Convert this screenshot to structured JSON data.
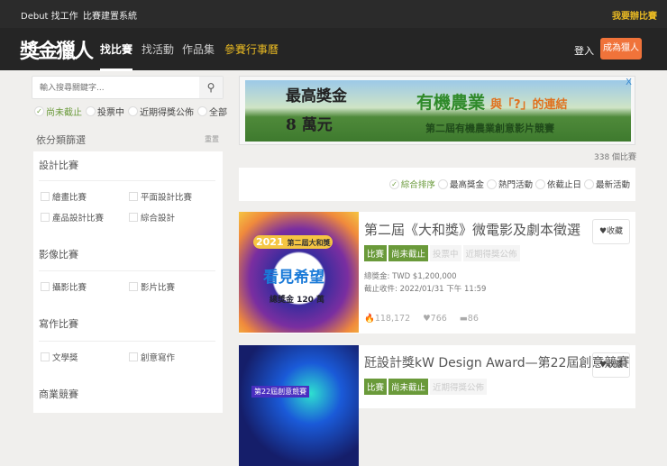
{
  "topbar": {
    "links": [
      "Debut 找工作",
      "比賽建置系統"
    ],
    "host": "我要辦比賽"
  },
  "nav": {
    "logo": "獎金獵人",
    "items": [
      "找比賽",
      "找活動",
      "作品集",
      "參賽行事曆"
    ],
    "login": "登入",
    "join": "成為獵人"
  },
  "search": {
    "placeholder": "輸入搜尋關鍵字...",
    "icon": "search-icon"
  },
  "status_filters": [
    {
      "label": "尚未截止",
      "checked": true
    },
    {
      "label": "投票中",
      "checked": false
    },
    {
      "label": "近期得獎公佈",
      "checked": false
    },
    {
      "label": "全部",
      "checked": false
    }
  ],
  "filter": {
    "title": "依分類篩選",
    "reset": "重置",
    "categories": [
      {
        "name": "設計比賽",
        "options": [
          "繪畫比賽",
          "平面設計比賽",
          "產品設計比賽",
          "綜合設計"
        ]
      },
      {
        "name": "影像比賽",
        "options": [
          "攝影比賽",
          "影片比賽"
        ]
      },
      {
        "name": "寫作比賽",
        "options": [
          "文學獎",
          "創意寫作"
        ]
      },
      {
        "name": "商業競賽",
        "options": []
      }
    ]
  },
  "ad": {
    "line1": "最高獎金",
    "line2": "8 萬元",
    "headline": "有機農業",
    "headline2": "與「?」的連結",
    "sub": "第二屆有機農業創意影片競賽",
    "close": "X"
  },
  "count": "338 個比賽",
  "sort": [
    {
      "label": "綜合排序",
      "checked": true
    },
    {
      "label": "最高獎金",
      "checked": false
    },
    {
      "label": "熱門活動",
      "checked": false
    },
    {
      "label": "依截止日",
      "checked": false
    },
    {
      "label": "最新活動",
      "checked": false
    }
  ],
  "contests": [
    {
      "title": "第二屆《大和獎》微電影及劇本徵選",
      "fav": "收藏",
      "tags": [
        {
          "t": "比賽",
          "on": true
        },
        {
          "t": "尚未截止",
          "on": true
        },
        {
          "t": "投票中",
          "on": false
        },
        {
          "t": "近期得獎公佈",
          "on": false
        }
      ],
      "prize": "總獎金: TWD $1,200,000",
      "deadline": "截止收件: 2022/01/31 下午 11:59",
      "views": "118,172",
      "likes": "766",
      "comments": "86",
      "thumb": {
        "year": "2021",
        "name": "第二屆大和獎",
        "slogan": "看見希望",
        "amount": "總獎金 120 萬"
      }
    },
    {
      "title": "瓩設計獎kW Design Award—第22屆創意競賽",
      "fav": "收藏",
      "tags": [
        {
          "t": "比賽",
          "on": true
        },
        {
          "t": "尚未截止",
          "on": true
        },
        {
          "t": "近期得獎公佈",
          "on": false
        }
      ],
      "thumb": {
        "name": "第22屆創意競賽"
      }
    }
  ]
}
